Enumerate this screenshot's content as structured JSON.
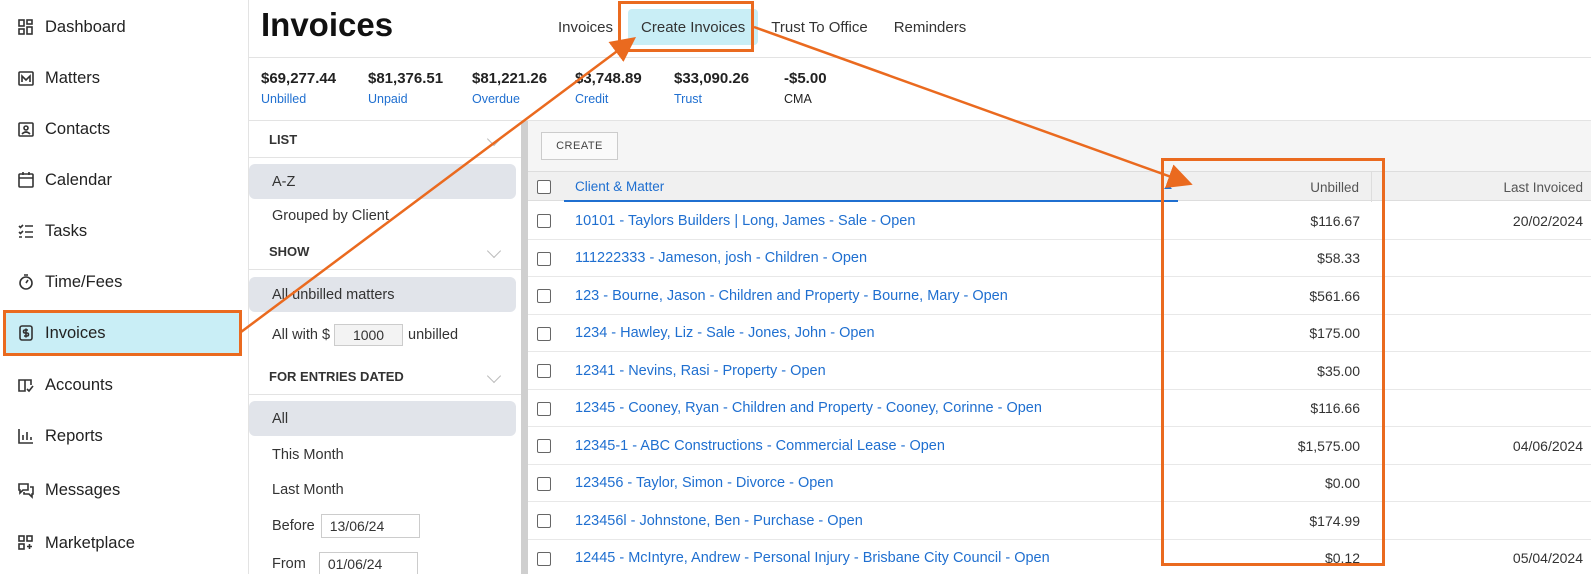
{
  "sidebar": {
    "items": [
      {
        "label": "Dashboard",
        "icon": "dashboard-icon"
      },
      {
        "label": "Matters",
        "icon": "matters-icon"
      },
      {
        "label": "Contacts",
        "icon": "contacts-icon"
      },
      {
        "label": "Calendar",
        "icon": "calendar-icon"
      },
      {
        "label": "Tasks",
        "icon": "tasks-icon"
      },
      {
        "label": "Time/Fees",
        "icon": "stopwatch-icon"
      },
      {
        "label": "Invoices",
        "icon": "invoice-dollar-icon",
        "active": true
      },
      {
        "label": "Accounts",
        "icon": "accounts-book-icon"
      },
      {
        "label": "Reports",
        "icon": "bar-chart-icon"
      },
      {
        "label": "Messages",
        "icon": "messages-icon"
      },
      {
        "label": "Marketplace",
        "icon": "marketplace-icon"
      }
    ]
  },
  "header": {
    "title": "Invoices",
    "tabs": [
      {
        "label": "Invoices"
      },
      {
        "label": "Create Invoices",
        "active": true
      },
      {
        "label": "Trust To Office"
      },
      {
        "label": "Reminders"
      }
    ]
  },
  "summary": [
    {
      "value": "$69,277.44",
      "label": "Unbilled"
    },
    {
      "value": "$81,376.51",
      "label": "Unpaid"
    },
    {
      "value": "$81,221.26",
      "label": "Overdue"
    },
    {
      "value": "$3,748.89",
      "label": "Credit"
    },
    {
      "value": "$33,090.26",
      "label": "Trust"
    },
    {
      "value": "-$5.00",
      "label": "CMA"
    }
  ],
  "filters": {
    "list_heading": "LIST",
    "list_options": [
      "A-Z",
      "Grouped by Client"
    ],
    "show_heading": "SHOW",
    "show_all_unbilled": "All unbilled matters",
    "show_all_with_prefix": "All with $",
    "show_amount": "1000",
    "show_all_with_suffix": "unbilled",
    "dated_heading": "FOR ENTRIES DATED",
    "dated_options": [
      "All",
      "This Month",
      "Last Month"
    ],
    "before_label": "Before",
    "before_value": "13/06/24",
    "from_label": "From",
    "from_value": "01/06/24"
  },
  "main": {
    "create_label": "CREATE",
    "columns": {
      "client": "Client & Matter",
      "unbilled": "Unbilled",
      "last_invoiced": "Last Invoiced"
    },
    "rows": [
      {
        "client": "10101 - Taylors Builders | Long, James - Sale - Open",
        "unbilled": "$116.67",
        "last": "20/02/2024"
      },
      {
        "client": "111222333 - Jameson, josh - Children - Open",
        "unbilled": "$58.33",
        "last": ""
      },
      {
        "client": "123 - Bourne, Jason - Children and Property - Bourne, Mary - Open",
        "unbilled": "$561.66",
        "last": ""
      },
      {
        "client": "1234 - Hawley, Liz - Sale - Jones, John - Open",
        "unbilled": "$175.00",
        "last": ""
      },
      {
        "client": "12341 - Nevins, Rasi - Property - Open",
        "unbilled": "$35.00",
        "last": ""
      },
      {
        "client": "12345 - Cooney, Ryan - Children and Property - Cooney, Corinne - Open",
        "unbilled": "$116.66",
        "last": ""
      },
      {
        "client": "12345-1 - ABC Constructions - Commercial Lease - Open",
        "unbilled": "$1,575.00",
        "last": "04/06/2024"
      },
      {
        "client": "123456 - Taylor, Simon - Divorce - Open",
        "unbilled": "$0.00",
        "last": ""
      },
      {
        "client": "123456l - Johnstone, Ben - Purchase - Open",
        "unbilled": "$174.99",
        "last": ""
      },
      {
        "client": "12445 - McIntyre, Andrew - Personal Injury - Brisbane City Council - Open",
        "unbilled": "$0.12",
        "last": "05/04/2024"
      }
    ]
  },
  "colors": {
    "accent": "#1f6fd0",
    "highlight": "#ea6a1f",
    "active_bg": "#c9eef6"
  }
}
